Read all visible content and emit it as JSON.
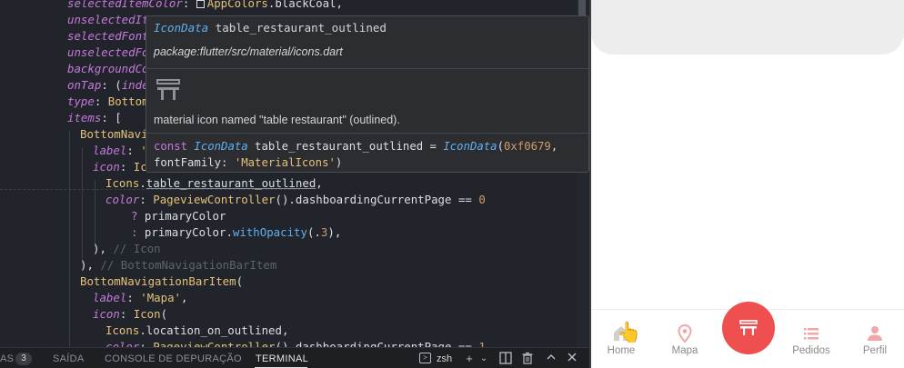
{
  "editor": {
    "lines": [
      {
        "indent": 74,
        "parts": [
          {
            "c": "t-prop",
            "k": "selectedItemColor"
          },
          {
            "c": "t-plain",
            "k": ": "
          },
          {
            "c": "swatch"
          },
          {
            "c": "t-type",
            "k": "AppColors"
          },
          {
            "c": "t-plain",
            "k": ".blackCoal,"
          }
        ]
      },
      {
        "indent": 74,
        "parts": [
          {
            "c": "t-prop",
            "k": "unselectedIt"
          }
        ]
      },
      {
        "indent": 74,
        "parts": [
          {
            "c": "t-prop",
            "k": "selectedFont"
          }
        ]
      },
      {
        "indent": 74,
        "parts": [
          {
            "c": "t-prop",
            "k": "unselectedFo"
          }
        ]
      },
      {
        "indent": 74,
        "parts": [
          {
            "c": "t-prop",
            "k": "backgroundCo"
          }
        ]
      },
      {
        "indent": 74,
        "parts": [
          {
            "c": "t-prop",
            "k": "onTap"
          },
          {
            "c": "t-plain",
            "k": ": ("
          },
          {
            "c": "t-prop",
            "k": "inde"
          }
        ]
      },
      {
        "indent": 74,
        "parts": [
          {
            "c": "t-prop",
            "k": "type"
          },
          {
            "c": "t-plain",
            "k": ": "
          },
          {
            "c": "t-type",
            "k": "Bottom"
          }
        ]
      },
      {
        "indent": 74,
        "parts": [
          {
            "c": "t-prop",
            "k": "items"
          },
          {
            "c": "t-plain",
            "k": ": ["
          }
        ]
      },
      {
        "indent": 88,
        "parts": [
          {
            "c": "t-type",
            "k": "BottomNavi"
          }
        ]
      },
      {
        "indent": 102,
        "parts": [
          {
            "c": "t-prop",
            "k": "label"
          },
          {
            "c": "t-plain",
            "k": ": "
          },
          {
            "c": "t-str",
            "k": "'"
          }
        ]
      },
      {
        "indent": 102,
        "parts": [
          {
            "c": "t-prop",
            "k": "icon"
          },
          {
            "c": "t-plain",
            "k": ": "
          },
          {
            "c": "t-type",
            "k": "Ic"
          }
        ]
      },
      {
        "indent": 116,
        "parts": [
          {
            "c": "t-type",
            "k": "Icons"
          },
          {
            "c": "t-plain",
            "k": "."
          },
          {
            "c": "t-link",
            "k": "table_restaurant_outlined"
          },
          {
            "c": "t-plain",
            "k": ","
          }
        ]
      },
      {
        "indent": 116,
        "parts": [
          {
            "c": "t-prop",
            "k": "color"
          },
          {
            "c": "t-plain",
            "k": ": "
          },
          {
            "c": "t-type",
            "k": "PageviewController"
          },
          {
            "c": "t-plain",
            "k": "()."
          },
          {
            "c": "t-plain",
            "k": "dashboardingCurrentPage == "
          },
          {
            "c": "t-num",
            "k": "0"
          }
        ]
      },
      {
        "indent": 144,
        "parts": [
          {
            "c": "t-kw",
            "k": "? "
          },
          {
            "c": "t-plain",
            "k": "primaryColor"
          }
        ]
      },
      {
        "indent": 144,
        "parts": [
          {
            "c": "t-kw",
            "k": ": "
          },
          {
            "c": "t-plain",
            "k": "primaryColor."
          },
          {
            "c": "t-fn",
            "k": "withOpacity"
          },
          {
            "c": "t-plain",
            "k": "(."
          },
          {
            "c": "t-num",
            "k": "3"
          },
          {
            "c": "t-plain",
            "k": "),"
          }
        ]
      },
      {
        "indent": 102,
        "parts": [
          {
            "c": "t-plain",
            "k": "), "
          },
          {
            "c": "t-cmt",
            "k": "// Icon"
          }
        ]
      },
      {
        "indent": 88,
        "parts": [
          {
            "c": "t-plain",
            "k": "), "
          },
          {
            "c": "t-cmt",
            "k": "// BottomNavigationBarItem"
          }
        ]
      },
      {
        "indent": 88,
        "parts": [
          {
            "c": "t-type",
            "k": "BottomNavigationBarItem"
          },
          {
            "c": "t-plain",
            "k": "("
          }
        ]
      },
      {
        "indent": 102,
        "parts": [
          {
            "c": "t-prop",
            "k": "label"
          },
          {
            "c": "t-plain",
            "k": ": "
          },
          {
            "c": "t-str",
            "k": "'Mapa'"
          },
          {
            "c": "t-plain",
            "k": ","
          }
        ]
      },
      {
        "indent": 102,
        "parts": [
          {
            "c": "t-prop",
            "k": "icon"
          },
          {
            "c": "t-plain",
            "k": ": "
          },
          {
            "c": "t-type",
            "k": "Icon"
          },
          {
            "c": "t-plain",
            "k": "("
          }
        ]
      },
      {
        "indent": 116,
        "parts": [
          {
            "c": "t-type",
            "k": "Icons"
          },
          {
            "c": "t-plain",
            "k": ".location_on_outlined,"
          }
        ]
      },
      {
        "indent": 116,
        "parts": [
          {
            "c": "t-prop",
            "k": "color"
          },
          {
            "c": "t-plain",
            "k": ": "
          },
          {
            "c": "t-type",
            "k": "PageviewController"
          },
          {
            "c": "t-plain",
            "k": "().dashboardingCurrentPage == "
          },
          {
            "c": "t-num",
            "k": "1"
          }
        ]
      }
    ]
  },
  "hover": {
    "sig_type": "IconData",
    "sig_name": "table_restaurant_outlined",
    "package": "package:flutter/src/material/icons.dart",
    "description": "material icon named \"table restaurant\" (outlined).",
    "code_line1_a": "const ",
    "code_line1_b": "IconData",
    "code_line1_c": " table_restaurant_outlined = ",
    "code_line1_d": "IconData",
    "code_line1_e": "(",
    "code_line1_f": "0xf0679",
    "code_line1_g": ",",
    "code_line2_a": "fontFamily: ",
    "code_line2_b": "'MaterialIcons'",
    "code_line2_c": ")"
  },
  "panel": {
    "tab_problems_suffix": "AS",
    "problems_count": "3",
    "tab_output": "SAÍDA",
    "tab_debug": "CONSOLE DE DEPURAÇÃO",
    "tab_terminal": "TERMINAL",
    "shell": "zsh"
  },
  "phone": {
    "nav": [
      {
        "label": "Home",
        "icon": "home-icon"
      },
      {
        "label": "Mapa",
        "icon": "location-icon"
      },
      {
        "label": "Pedidos",
        "icon": "list-icon"
      },
      {
        "label": "Perfil",
        "icon": "person-icon"
      }
    ],
    "accent": "#ef4f4f"
  }
}
